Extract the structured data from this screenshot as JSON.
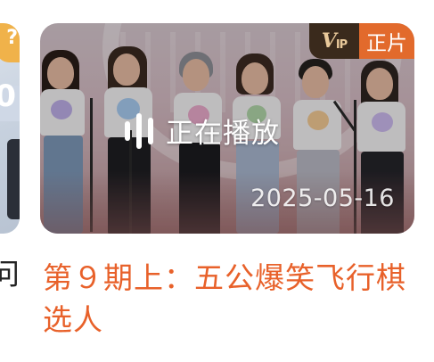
{
  "prev_card": {
    "badge_text": "?",
    "digit_text": "0",
    "title_fragment": "问"
  },
  "card": {
    "badge": {
      "vip_label": "V",
      "vip_suffix": "IP",
      "type_label": "正片"
    },
    "status_text": "正在播放",
    "date": "2025-05-16",
    "title": "第９期上：五公爆笑飞行棋选人"
  },
  "colors": {
    "title": "#e8612a",
    "badge_type_bg": "#e26a2c",
    "badge_vip_bg": "#3a2a1c",
    "badge_vip_text": "#e9c99a",
    "prev_badge": "#f0b24a"
  },
  "icons": {
    "playing": "equalizer-bars-icon",
    "vip": "vip-icon"
  }
}
